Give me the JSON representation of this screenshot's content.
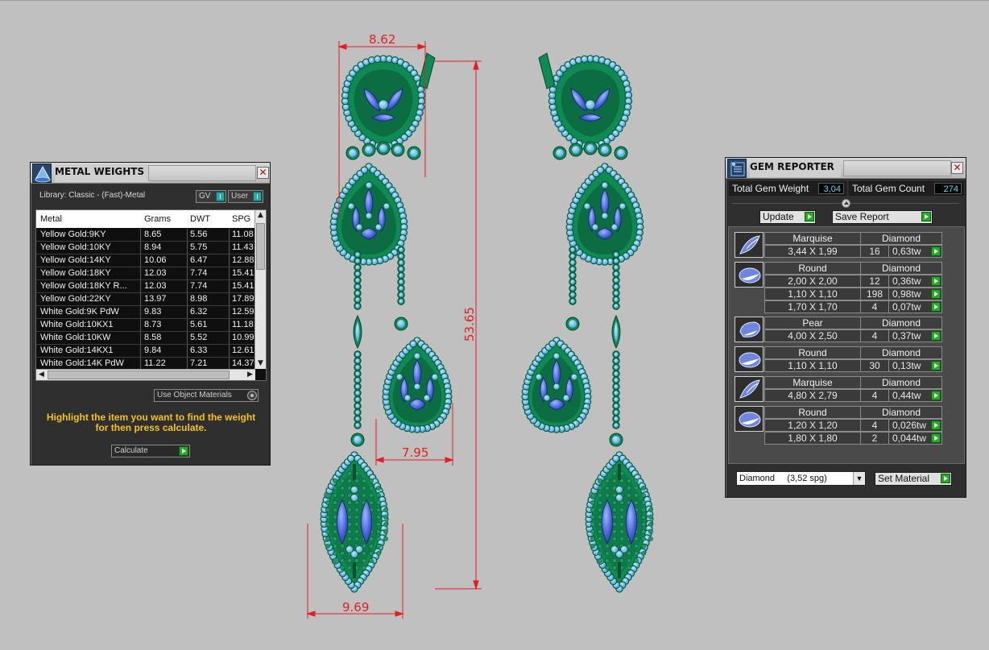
{
  "drawing": {
    "dim_top_width": "8.62",
    "dim_height": "53.65",
    "dim_mid_width": "7.95",
    "dim_bottom_width": "9.69"
  },
  "metal_weights": {
    "title": "METAL WEIGHTS",
    "close_glyph": "✕",
    "library_label": "Library: Classic - (Fast)-Metal",
    "gv_label": "GV",
    "user_label": "User",
    "columns": [
      "Metal",
      "Grams",
      "DWT",
      "SPG"
    ],
    "rows": [
      {
        "metal": "Yellow Gold:9KY",
        "grams": "8.65",
        "dwt": "5.56",
        "spg": "11.08"
      },
      {
        "metal": "Yellow Gold:10KY",
        "grams": "8.94",
        "dwt": "5.75",
        "spg": "11.43"
      },
      {
        "metal": "Yellow Gold:14KY",
        "grams": "10.06",
        "dwt": "6.47",
        "spg": "12.88"
      },
      {
        "metal": "Yellow Gold:18KY",
        "grams": "12.03",
        "dwt": "7.74",
        "spg": "15.41"
      },
      {
        "metal": "Yellow Gold:18KY R...",
        "grams": "12.03",
        "dwt": "7.74",
        "spg": "15.41"
      },
      {
        "metal": "Yellow Gold:22KY",
        "grams": "13.97",
        "dwt": "8.98",
        "spg": "17.89"
      },
      {
        "metal": "White Gold:9K PdW",
        "grams": "9.83",
        "dwt": "6.32",
        "spg": "12.59"
      },
      {
        "metal": "White Gold:10KX1",
        "grams": "8.73",
        "dwt": "5.61",
        "spg": "11.18"
      },
      {
        "metal": "White Gold:10KW",
        "grams": "8.58",
        "dwt": "5.52",
        "spg": "10.99"
      },
      {
        "metal": "White Gold:14KX1",
        "grams": "9.84",
        "dwt": "6.33",
        "spg": "12.61"
      },
      {
        "metal": "White Gold:14K PdW",
        "grams": "11.22",
        "dwt": "7.21",
        "spg": "14.37"
      }
    ],
    "use_object_materials": "Use Object Materials",
    "hint_line1": "Highlight the item you want to find the weight",
    "hint_line2": "for then press calculate.",
    "calculate_label": "Calculate"
  },
  "gem_reporter": {
    "title": "GEM REPORTER",
    "close_glyph": "✕",
    "total_weight_label": "Total Gem Weight",
    "total_weight_value": "3,04",
    "total_count_label": "Total Gem Count",
    "total_count_value": "274",
    "update_label": "Update",
    "save_report_label": "Save Report",
    "groups": [
      {
        "shape": "Marquise",
        "material": "Diamond",
        "thumb": "marquise",
        "rows": [
          {
            "size": "3,44 X 1,99",
            "count": "16",
            "tw": "0,63tw"
          }
        ]
      },
      {
        "shape": "Round",
        "material": "Diamond",
        "thumb": "round",
        "rows": [
          {
            "size": "2,00 X 2,00",
            "count": "12",
            "tw": "0,36tw"
          },
          {
            "size": "1,10 X 1,10",
            "count": "198",
            "tw": "0,98tw"
          },
          {
            "size": "1,70 X 1,70",
            "count": "4",
            "tw": "0,07tw"
          }
        ]
      },
      {
        "shape": "Pear",
        "material": "Diamond",
        "thumb": "pear",
        "rows": [
          {
            "size": "4,00 X 2,50",
            "count": "4",
            "tw": "0,37tw"
          }
        ]
      },
      {
        "shape": "Round",
        "material": "Diamond",
        "thumb": "round",
        "rows": [
          {
            "size": "1,10 X 1,10",
            "count": "30",
            "tw": "0,13tw"
          }
        ]
      },
      {
        "shape": "Marquise",
        "material": "Diamond",
        "thumb": "marquise",
        "rows": [
          {
            "size": "4,80 X 2,79",
            "count": "4",
            "tw": "0,44tw"
          }
        ]
      },
      {
        "shape": "Round",
        "material": "Diamond",
        "thumb": "round",
        "rows": [
          {
            "size": "1,20 X 1,20",
            "count": "4",
            "tw": "0,026tw"
          },
          {
            "size": "1,80 X 1,80",
            "count": "2",
            "tw": "0,044tw"
          }
        ]
      }
    ],
    "material_select": "Diamond     (3,52 spg)",
    "set_material_label": "Set Material"
  },
  "colors": {
    "background": "#c0c0c0",
    "metal_green": "#0f8a52",
    "accent_stone": "#69b8ee",
    "center_stone": "#3f5fd0",
    "dimension_red": "#e02020",
    "hint_yellow": "#f4c21a"
  }
}
